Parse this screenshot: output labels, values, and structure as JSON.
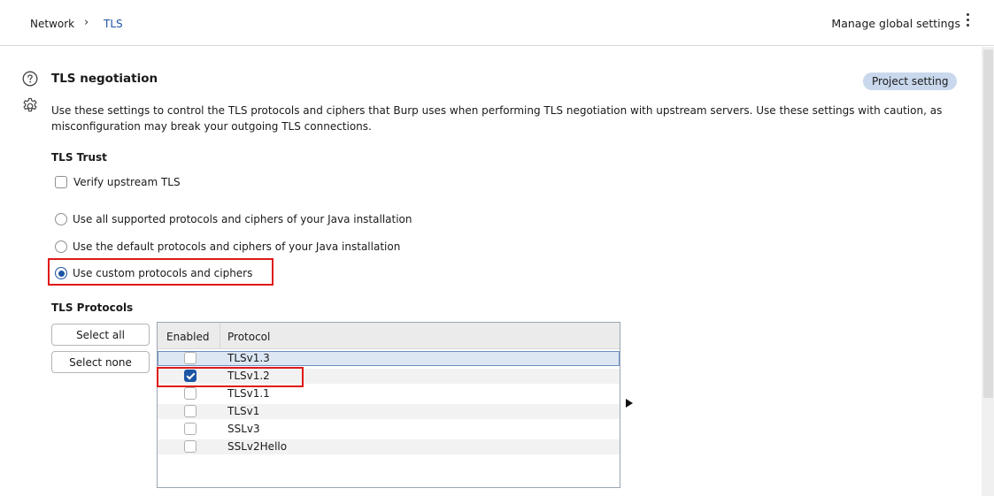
{
  "breadcrumb": {
    "parent": "Network",
    "separator": "›",
    "current": "TLS"
  },
  "header": {
    "manage_label": "Manage global settings"
  },
  "section": {
    "title": "TLS negotiation",
    "badge": "Project setting",
    "description": "Use these settings to control the TLS protocols and ciphers that Burp uses when performing TLS negotiation with upstream servers. Use these settings with caution, as misconfiguration may break your outgoing TLS connections."
  },
  "trust": {
    "label": "TLS Trust",
    "verify_label": "Verify upstream TLS",
    "verify_checked": false
  },
  "protocol_mode": {
    "options": [
      {
        "label": "Use all supported protocols and ciphers of your Java installation",
        "selected": false
      },
      {
        "label": "Use the default protocols and ciphers of your Java installation",
        "selected": false
      },
      {
        "label": "Use custom protocols and ciphers",
        "selected": true
      }
    ]
  },
  "protocols": {
    "label": "TLS Protocols",
    "select_all_label": "Select all",
    "select_none_label": "Select none",
    "columns": [
      "Enabled",
      "Protocol"
    ],
    "rows": [
      {
        "protocol": "TLSv1.3",
        "enabled": false,
        "selected": true
      },
      {
        "protocol": "TLSv1.2",
        "enabled": true,
        "selected": false
      },
      {
        "protocol": "TLSv1.1",
        "enabled": false,
        "selected": false
      },
      {
        "protocol": "TLSv1",
        "enabled": false,
        "selected": false
      },
      {
        "protocol": "SSLv3",
        "enabled": false,
        "selected": false
      },
      {
        "protocol": "SSLv2Hello",
        "enabled": false,
        "selected": false
      }
    ]
  },
  "colors": {
    "accent": "#1d55a4",
    "highlight": "#e01818",
    "badge_bg": "#c9d8ec"
  }
}
